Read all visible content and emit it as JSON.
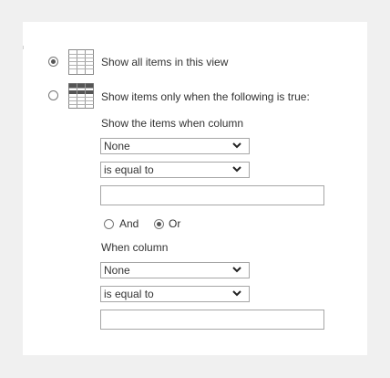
{
  "filter": {
    "options": [
      {
        "label": "Show all items in this view",
        "selected": true,
        "icon": "table-grid-icon"
      },
      {
        "label": "Show items only when the following is true:",
        "selected": false,
        "icon": "table-filter-icon"
      }
    ],
    "condition1": {
      "heading": "Show the items when column",
      "column_value": "None",
      "operator_value": "is equal to",
      "value": ""
    },
    "logic": {
      "and_label": "And",
      "or_label": "Or",
      "selected": "Or"
    },
    "condition2": {
      "heading": "When column",
      "column_value": "None",
      "operator_value": "is equal to",
      "value": ""
    }
  },
  "colors": {
    "background": "#f0f0f0",
    "panel": "#ffffff",
    "border": "#a6a6a6",
    "text": "#333333"
  }
}
